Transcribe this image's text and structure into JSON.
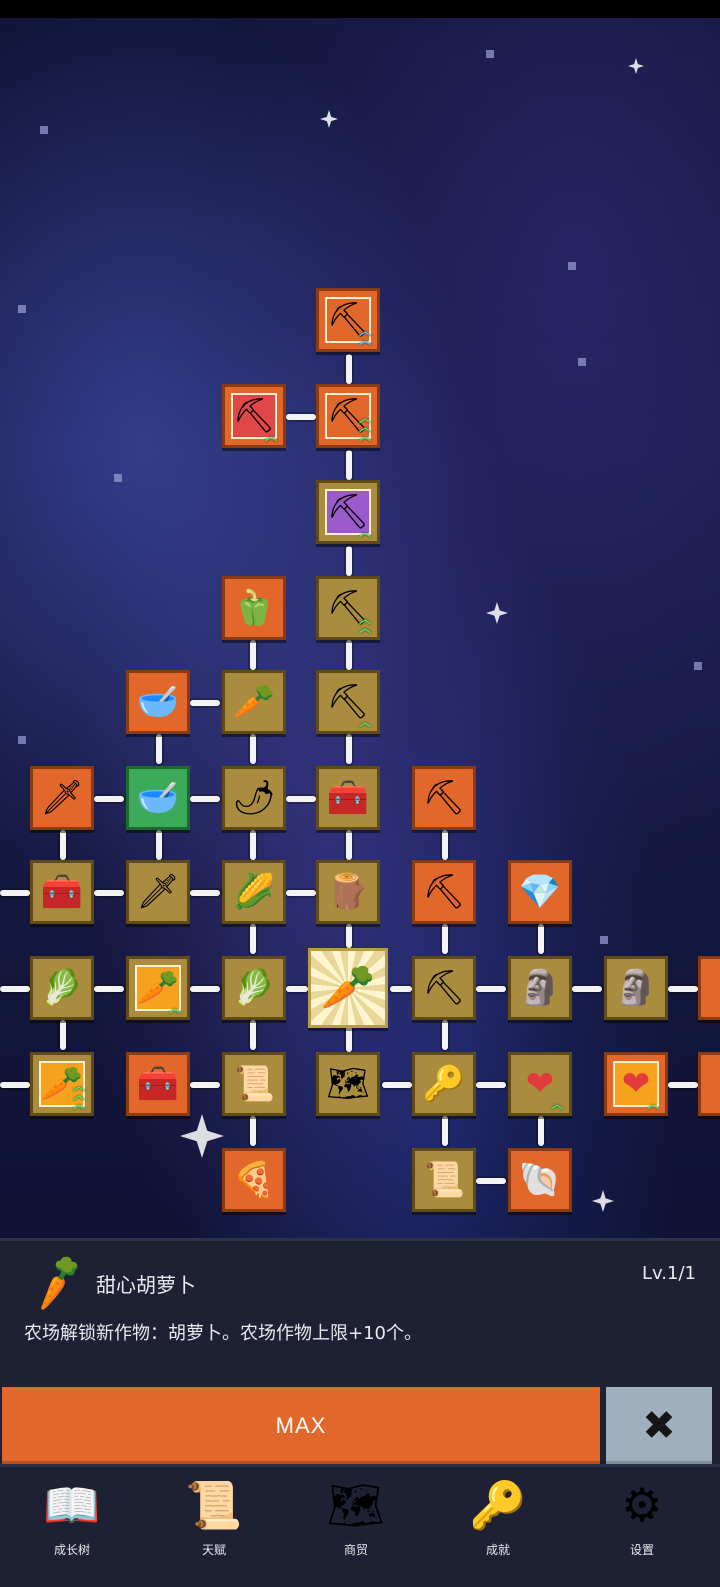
{
  "selected_item": {
    "icon": "carrot-icon",
    "title": "甜心胡萝卜",
    "level": "Lv.1/1",
    "description": "农场解锁新作物：胡萝卜。农场作物上限+10个。"
  },
  "actions": {
    "max_label": "MAX",
    "close_icon": "close-icon"
  },
  "nav": [
    {
      "label": "成长树",
      "icon": "book-icon"
    },
    {
      "label": "天赋",
      "icon": "scroll-icon"
    },
    {
      "label": "商贸",
      "icon": "map-icon"
    },
    {
      "label": "成就",
      "icon": "key-icon"
    },
    {
      "label": "设置",
      "icon": "gear-icon"
    }
  ],
  "tree_icons": {
    "shovel": "⛏",
    "pepper": "🫑",
    "radish": "🥕",
    "bowl": "🥣",
    "sword": "🗡",
    "chili": "🌶",
    "chest": "🧰",
    "pickaxe": "⛏",
    "crystal": "💎",
    "cabbage": "🥬",
    "corn": "🌽",
    "carrot": "🥕",
    "statue": "🗿",
    "heart": "❤",
    "key": "🔑",
    "scroll": "📜",
    "treasure": "🪙",
    "map": "🗺",
    "pizza": "🍕",
    "fossil": "🐚",
    "stick": "🪵",
    "fish": "🐟"
  },
  "colors": {
    "orange": "#e2672a",
    "gold": "#a98c3e",
    "green": "#3daa5a",
    "panel": "#1d2133",
    "close_button": "#9fb0bd"
  }
}
